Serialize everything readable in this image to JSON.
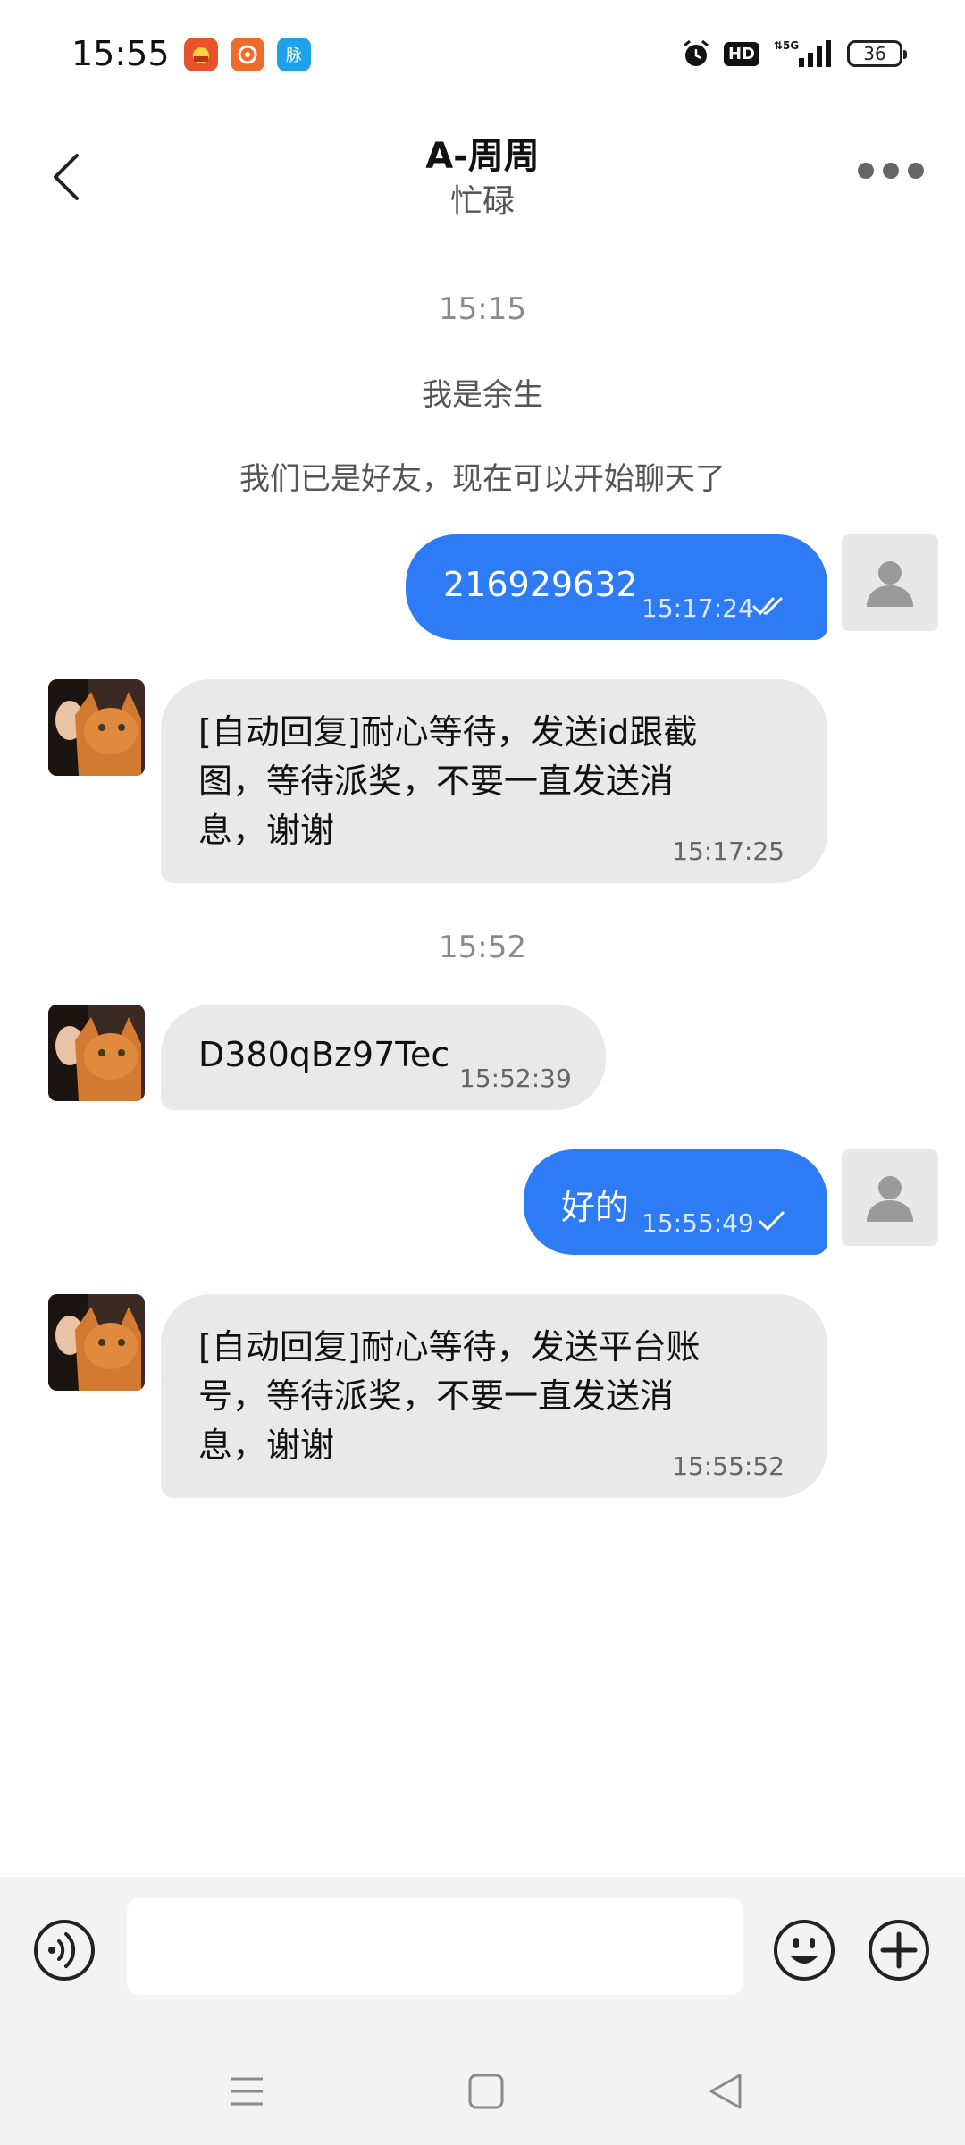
{
  "status_bar": {
    "time": "15:55",
    "app_icons": [
      "news-app-icon",
      "video-app-icon",
      "chat-app-icon"
    ],
    "app_icon_text": [
      "",
      "",
      "脉"
    ],
    "battery": "36",
    "network": "5G"
  },
  "header": {
    "title": "A-周周",
    "subtitle": "忙碌"
  },
  "messages": [
    {
      "type": "time",
      "text": "15:15"
    },
    {
      "type": "system",
      "text": "我是余生"
    },
    {
      "type": "system",
      "text": "我们已是好友，现在可以开始聊天了"
    },
    {
      "type": "sent",
      "text": "216929632",
      "time": "15:17:24",
      "status": "read"
    },
    {
      "type": "received",
      "lines": [
        "[自动回复]耐心等待，发送id跟截",
        "图，等待派奖，不要一直发送消",
        "息，谢谢"
      ],
      "time": "15:17:25"
    },
    {
      "type": "time",
      "text": "15:52"
    },
    {
      "type": "received",
      "text": "D380qBz97Tec",
      "time": "15:52:39"
    },
    {
      "type": "sent",
      "text": "好的",
      "time": "15:55:49",
      "status": "sent"
    },
    {
      "type": "received",
      "lines": [
        "[自动回复]耐心等待，发送平台账",
        "号，等待派奖，不要一直发送消",
        "息，谢谢"
      ],
      "time": "15:55:52"
    }
  ],
  "input": {
    "placeholder": "",
    "value": ""
  },
  "colors": {
    "sent_bubble": "#2e7bf6",
    "received_bubble": "#e9e9e9",
    "input_bar": "#f3f3f3"
  }
}
